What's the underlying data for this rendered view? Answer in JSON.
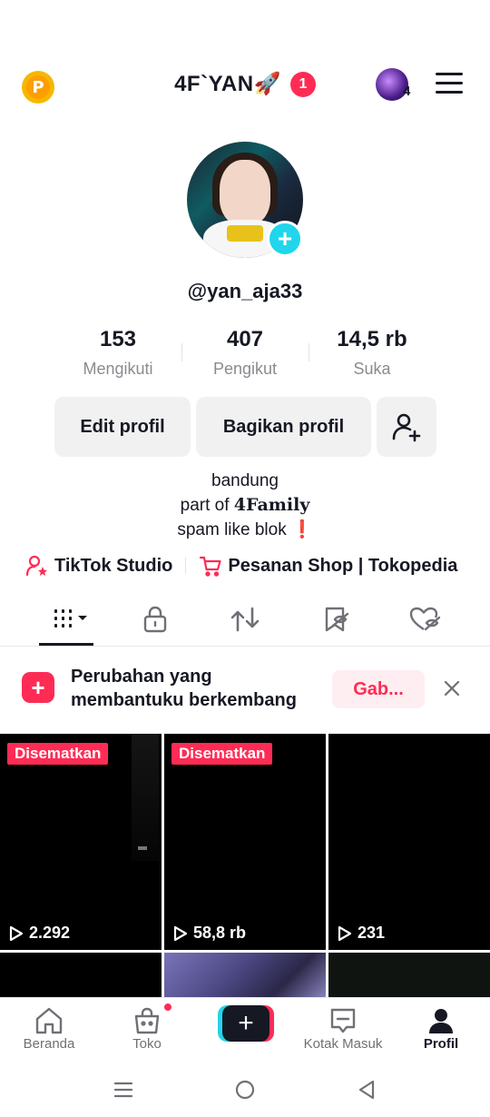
{
  "header": {
    "title": "4F`YAN🚀",
    "notification_count": "1",
    "account_count": "4"
  },
  "profile": {
    "username": "@yan_aja33",
    "stats": [
      {
        "value": "153",
        "label": "Mengikuti"
      },
      {
        "value": "407",
        "label": "Pengikut"
      },
      {
        "value": "14,5 rb",
        "label": "Suka"
      }
    ],
    "edit_label": "Edit profil",
    "share_label": "Bagikan profil",
    "bio_line1": "bandung",
    "bio_line2_prefix": "part of ",
    "bio_line2_bold": "4Family",
    "bio_line3": "spam like blok ❗"
  },
  "links": {
    "studio": "TikTok Studio",
    "shop": "Pesanan Shop | Tokopedia"
  },
  "banner": {
    "line1": "Perubahan yang",
    "line2": "membantuku berkembang",
    "button": "Gab..."
  },
  "videos": [
    {
      "pinned": "Disematkan",
      "views": "2.292"
    },
    {
      "pinned": "Disematkan",
      "views": "58,8 rb"
    },
    {
      "pinned": "",
      "views": "231"
    }
  ],
  "nav": {
    "home": "Beranda",
    "shop": "Toko",
    "inbox": "Kotak Masuk",
    "profile": "Profil"
  },
  "colors": {
    "accent": "#fe2c55",
    "cyan": "#20d5ec",
    "text": "#161823",
    "muted": "#8a8b91"
  }
}
